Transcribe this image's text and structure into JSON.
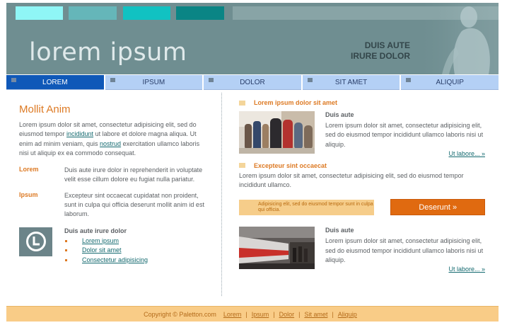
{
  "header": {
    "title": "lorem ipsum",
    "subtitle_line1": "DUIS AUTE",
    "subtitle_line2": "IRURE DOLOR",
    "swatches": [
      "#8ff6f6",
      "#65b6b9",
      "#11c2c2",
      "#0a8585"
    ]
  },
  "nav": {
    "items": [
      {
        "label": "LOREM",
        "active": true
      },
      {
        "label": "IPSUM",
        "active": false
      },
      {
        "label": "DOLOR",
        "active": false
      },
      {
        "label": "SIT AMET",
        "active": false
      },
      {
        "label": "ALIQUIP",
        "active": false
      }
    ]
  },
  "left": {
    "heading": "Mollit Anim",
    "intro_part1": "Lorem ipsum dolor sit amet, consectetur adipisicing elit, sed do eiusmod tempor ",
    "intro_link1": "incididunt",
    "intro_part2": " ut labore et dolore magna aliqua. Ut enim ad minim veniam, quis ",
    "intro_link2": "nostrud",
    "intro_part3": " exercitation ullamco laboris nisi ut aliquip ex ea commodo consequat.",
    "defs": [
      {
        "term": "Lorem",
        "desc": "Duis aute irure dolor in reprehenderit in voluptate velit esse cillum dolore eu fugiat nulla pariatur."
      },
      {
        "term": "Ipsum",
        "desc": "Excepteur sint occaecat cupidatat non proident, sunt in culpa qui officia deserunt mollit anim id est laborum."
      }
    ],
    "logo_list_title": "Duis aute irure dolor",
    "logo_links": [
      "Lorem ipsum",
      "Dolor sit amet",
      "Consectetur adipisicing"
    ]
  },
  "right": {
    "section1_heading": "Lorem ipsum dolor sit amet",
    "news1": {
      "title": "Duis aute",
      "text": "Lorem ipsum dolor sit amet, consectetur adipisicing elit, sed do eiusmod tempor incididunt ullamco laboris nisi ut aliquip.",
      "more": "Ut labore... »"
    },
    "section2_heading": "Excepteur sint occaecat",
    "section2_text": "Lorem ipsum dolor sit amet, consectetur adipisicing elit, sed do eiusmod tempor incididunt ullamco.",
    "cta_note": "Adipisicing elit, sed do eiusmod tempor sunt in culpa qui officia.",
    "cta_button": "Deserunt »",
    "news2": {
      "title": "Duis aute",
      "text": "Lorem ipsum dolor sit amet, consectetur adipisicing elit, sed do eiusmod tempor incididunt ullamco laboris nisi ut aliquip.",
      "more": "Ut labore... »"
    }
  },
  "footer": {
    "copyright": "Copyright © Paletton.com",
    "links": [
      "Lorem",
      "Ipsum",
      "Dolor",
      "Sit amet",
      "Aliquip"
    ]
  }
}
